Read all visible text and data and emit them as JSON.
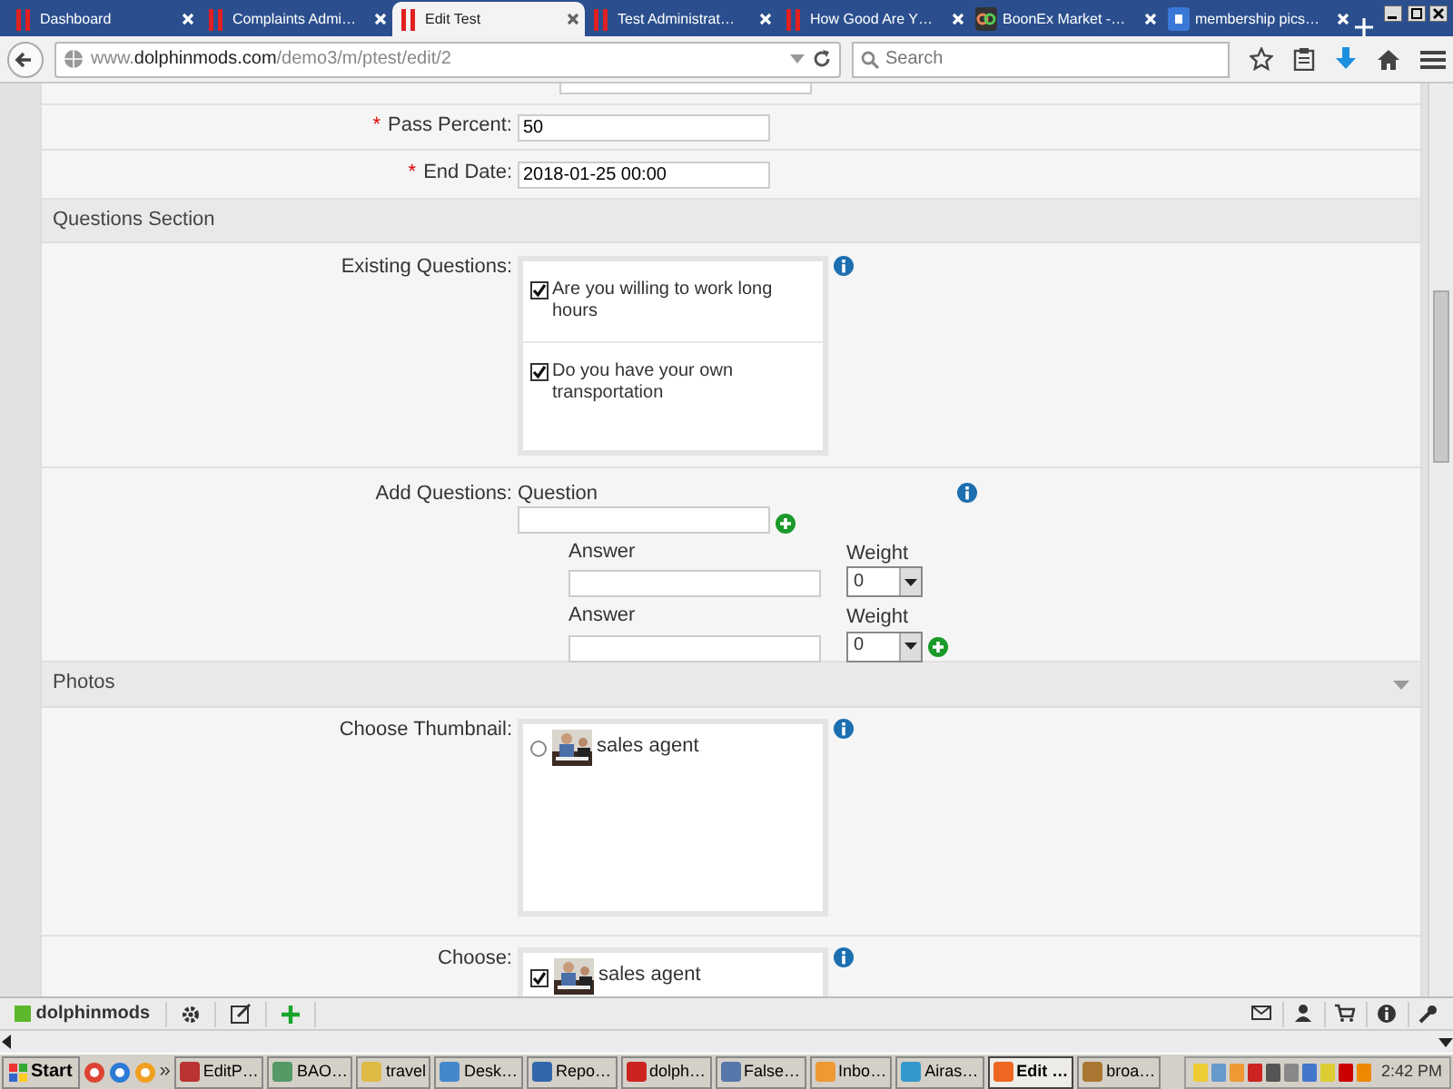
{
  "tabs": [
    {
      "label": "Dashboard",
      "kind": "dolphin",
      "selected": false
    },
    {
      "label": "Complaints Admi…",
      "kind": "dolphin",
      "selected": false
    },
    {
      "label": "Edit Test",
      "kind": "dolphin",
      "selected": true
    },
    {
      "label": "Test Administrat…",
      "kind": "dolphin",
      "selected": false
    },
    {
      "label": "How Good Are Y…",
      "kind": "dolphin",
      "selected": false
    },
    {
      "label": "BoonEx Market -…",
      "kind": "boonex",
      "selected": false
    },
    {
      "label": "membership pics…",
      "kind": "google",
      "selected": false
    }
  ],
  "address_bar": {
    "url": "www.**dolphinmods.com**/demo3/m/ptest/edit/2"
  },
  "search": {
    "placeholder": "Search"
  },
  "fields": [
    {
      "required_mark": "*",
      "label": "Pass Percent:",
      "value": "50"
    },
    {
      "required_mark": "*",
      "label": "End Date:",
      "value": "2018-01-25 00:00"
    }
  ],
  "questions_section": {
    "title": "Questions Section",
    "existing": {
      "label": "Existing Questions:",
      "items": [
        {
          "text": "Are you willing to work long hours",
          "checked": true
        },
        {
          "text": "Do you have your own transportation",
          "checked": true
        }
      ]
    },
    "add": {
      "label": "Add Questions:",
      "question_label": "Question",
      "answers": [
        {
          "label": "Answer",
          "weight_label": "Weight",
          "weight": "0"
        },
        {
          "label": "Answer",
          "weight_label": "Weight",
          "weight": "0"
        }
      ]
    }
  },
  "photos_section": {
    "title": "Photos",
    "thumbnail": {
      "label": "Choose Thumbnail:",
      "items": [
        {
          "text": "sales agent",
          "selected": false
        }
      ]
    },
    "choose": {
      "label": "Choose:",
      "items": [
        {
          "text": "sales agent",
          "checked": true
        }
      ]
    }
  },
  "toolbar": {
    "site": "dolphinmods"
  },
  "taskbar": {
    "start": "Start",
    "more": "»",
    "items": [
      {
        "label": "EditP…",
        "selected": false
      },
      {
        "label": "BAO…",
        "selected": false
      },
      {
        "label": "travel",
        "selected": false
      },
      {
        "label": "Desk…",
        "selected": false
      },
      {
        "label": "Repo…",
        "selected": false
      },
      {
        "label": "dolph…",
        "selected": false
      },
      {
        "label": "False…",
        "selected": false
      },
      {
        "label": "Inbo…",
        "selected": false
      },
      {
        "label": "Airas…",
        "selected": false
      },
      {
        "label": "Edit …",
        "selected": true
      },
      {
        "label": "broa…",
        "selected": false
      }
    ],
    "clock": "2:42 PM"
  }
}
